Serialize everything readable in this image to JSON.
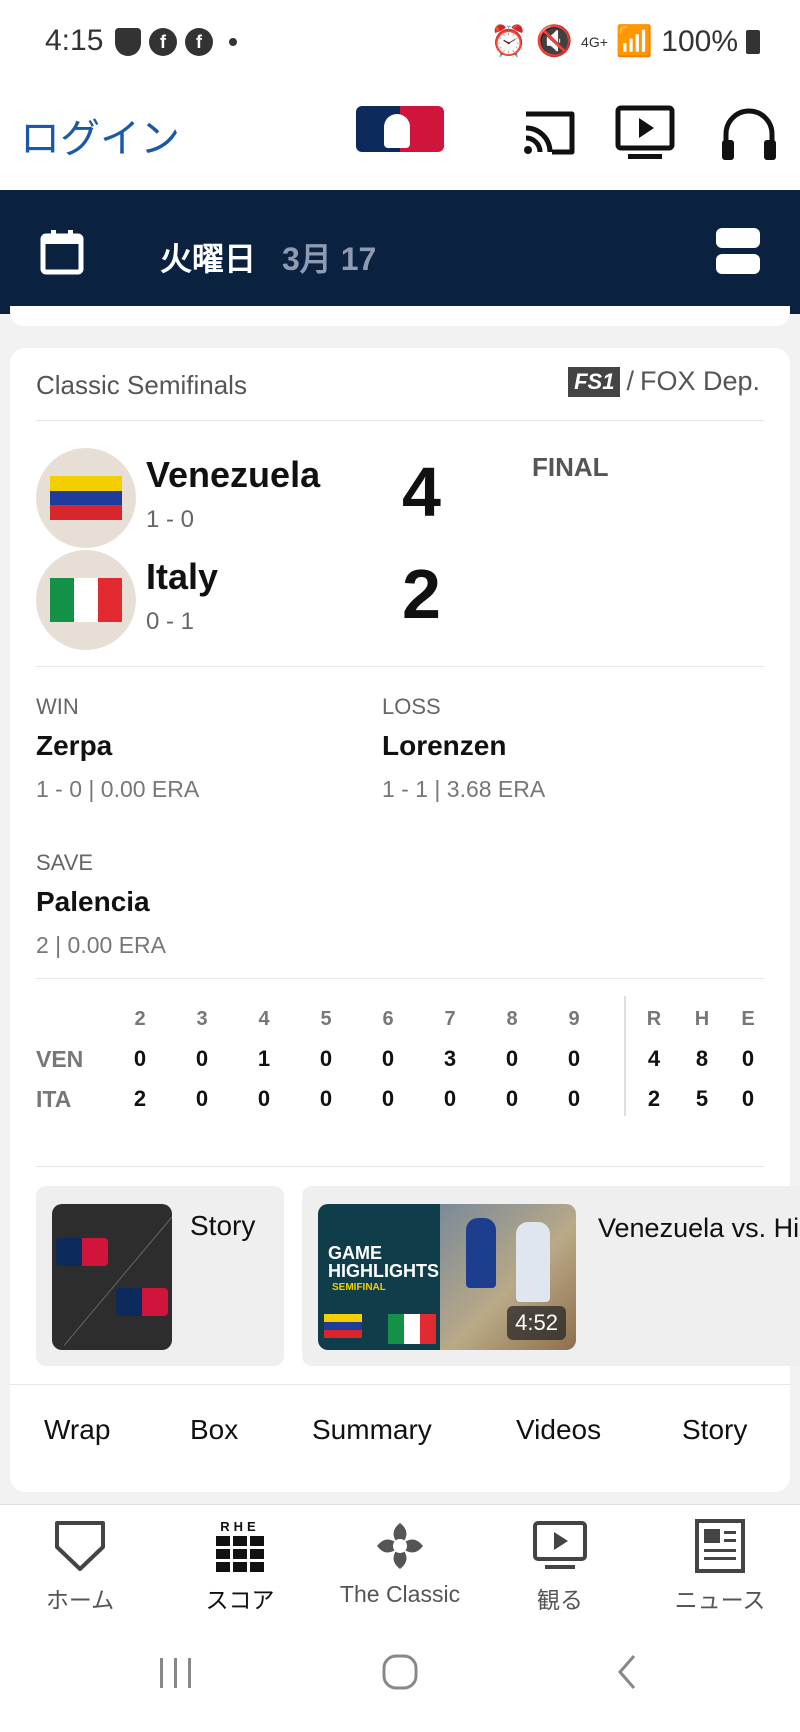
{
  "status_bar": {
    "time": "4:15",
    "battery": "100%",
    "network": "4G+"
  },
  "header": {
    "login_label": "ログイン",
    "icons": [
      "mlb-logo",
      "cast-icon",
      "tv-icon",
      "headphones-icon"
    ]
  },
  "date_bar": {
    "day": "火曜日",
    "date": "3月 17"
  },
  "game": {
    "title": "Classic Semifinals",
    "network": {
      "fs1": "FS1",
      "separator": "/",
      "other": "FOX Dep."
    },
    "status": "FINAL",
    "away": {
      "name": "Venezuela",
      "record": "1 - 0",
      "score": "4"
    },
    "home": {
      "name": "Italy",
      "record": "0 - 1",
      "score": "2"
    },
    "pitchers": {
      "win": {
        "label": "WIN",
        "name": "Zerpa",
        "stat": "1 - 0 | 0.00 ERA"
      },
      "loss": {
        "label": "LOSS",
        "name": "Lorenzen",
        "stat": "1 - 1 | 3.68 ERA"
      },
      "save": {
        "label": "SAVE",
        "name": "Palencia",
        "stat": "2 | 0.00 ERA"
      }
    },
    "linescore": {
      "innings": [
        "2",
        "3",
        "4",
        "5",
        "6",
        "7",
        "8",
        "9"
      ],
      "totals_headers": [
        "R",
        "H",
        "E"
      ],
      "rows": [
        {
          "team": "VEN",
          "innings": [
            "0",
            "0",
            "1",
            "0",
            "0",
            "3",
            "0",
            "0"
          ],
          "totals": [
            "4",
            "8",
            "0"
          ]
        },
        {
          "team": "ITA",
          "innings": [
            "2",
            "0",
            "0",
            "0",
            "0",
            "0",
            "0",
            "0"
          ],
          "totals": [
            "2",
            "5",
            "0"
          ]
        }
      ]
    },
    "media": {
      "story_label": "Story",
      "highlight_title": "Venezuela vs. Highlights",
      "highlight_thumb_text": "GAME HIGHLIGHTS",
      "highlight_thumb_sub": "SEMIFINAL",
      "highlight_duration": "4:52"
    },
    "tabs": [
      "Wrap",
      "Box",
      "Summary",
      "Videos",
      "Story"
    ]
  },
  "bottom_nav": {
    "items": [
      {
        "label": "ホーム",
        "icon": "home-plate-icon"
      },
      {
        "label": "スコア",
        "icon": "scores-grid-icon",
        "icon_text": "RHE"
      },
      {
        "label": "The Classic",
        "icon": "classic-logo-icon"
      },
      {
        "label": "観る",
        "icon": "watch-icon"
      },
      {
        "label": "ニュース",
        "icon": "news-icon"
      }
    ]
  }
}
